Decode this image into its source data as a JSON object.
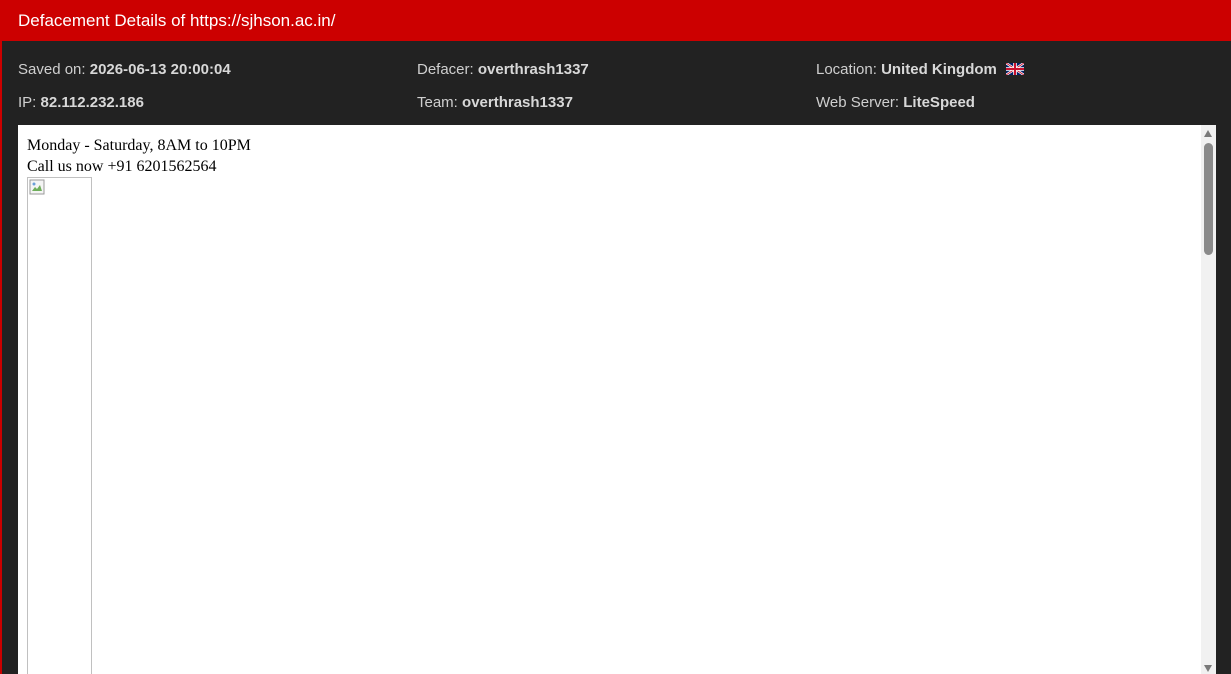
{
  "header": {
    "title": "Defacement Details of https://sjhson.ac.in/"
  },
  "meta": {
    "saved_on_label": "Saved on:",
    "saved_on_value": "2026-06-13 20:00:04",
    "defacer_label": "Defacer:",
    "defacer_value": "overthrash1337",
    "location_label": "Location:",
    "location_value": "United Kingdom",
    "location_flag_icon": "uk-flag-icon",
    "ip_label": "IP:",
    "ip_value": "82.112.232.186",
    "team_label": "Team:",
    "team_value": "overthrash1337",
    "web_server_label": "Web Server:",
    "web_server_value": "LiteSpeed"
  },
  "viewer": {
    "line1": "Monday - Saturday, 8AM to 10PM",
    "line2": "Call us now +91 6201562564",
    "broken_image_icon": "broken-image-icon"
  },
  "colors": {
    "header_bg": "#cc0000",
    "panel_bg": "#222222",
    "viewer_bg": "#ffffff"
  }
}
